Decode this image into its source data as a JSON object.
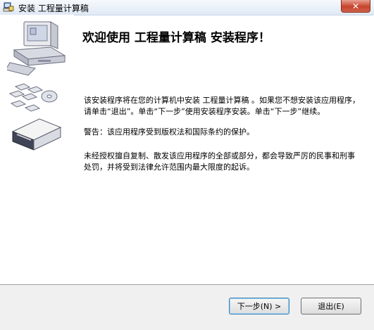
{
  "window": {
    "title": "安装 工程量计算稿",
    "close_glyph": "✕"
  },
  "heading": "欢迎使用 工程量计算稿 安装程序！",
  "paragraphs": [
    "该安装程序将在您的计算机中安装 工程量计算稿 。如果您不想安装该应用程序，请单击“退出”。单击“下一步”使用安装程序安装。单击“下一步”继续。",
    "警告：该应用程序受到版权法和国际条约的保护。",
    "未经授权擅自复制、散发该应用程序的全部或部分，都会导致严厉的民事和刑事处罚，并将受到法律允许范围内最大限度的起诉。"
  ],
  "buttons": {
    "next": "下一步(N) >",
    "exit": "退出(E)"
  },
  "icons": {
    "app": "installer-icon",
    "graphic": "computer-and-discs-illustration"
  }
}
